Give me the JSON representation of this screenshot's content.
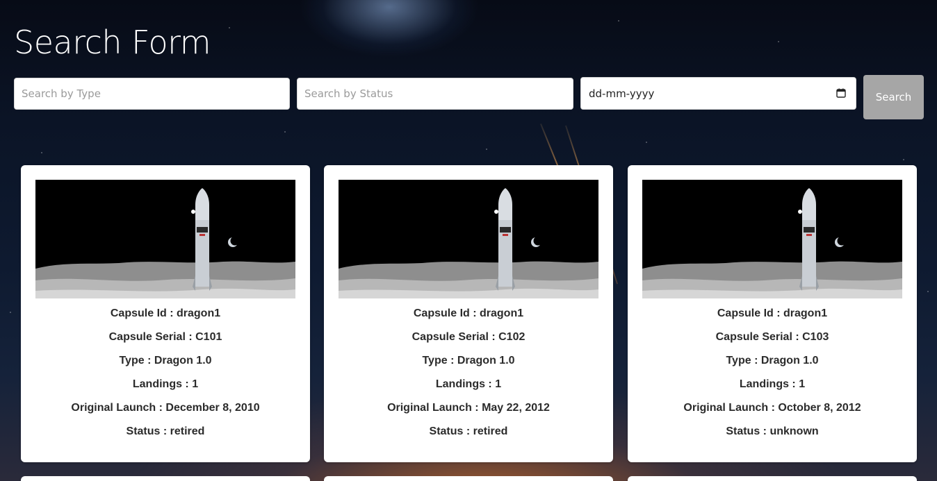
{
  "page": {
    "title": "Search Form"
  },
  "search": {
    "type_placeholder": "Search by Type",
    "status_placeholder": "Search by Status",
    "date_placeholder": "dd-mm-yyyy",
    "button_label": "Search"
  },
  "labels": {
    "capsule_id": "Capsule Id",
    "capsule_serial": "Capsule Serial",
    "type": "Type",
    "landings": "Landings",
    "original_launch": "Original Launch",
    "status": "Status"
  },
  "capsules": [
    {
      "capsule_id": "dragon1",
      "capsule_serial": "C101",
      "type": "Dragon 1.0",
      "landings": "1",
      "original_launch": "December 8, 2010",
      "status": "retired"
    },
    {
      "capsule_id": "dragon1",
      "capsule_serial": "C102",
      "type": "Dragon 1.0",
      "landings": "1",
      "original_launch": "May 22, 2012",
      "status": "retired"
    },
    {
      "capsule_id": "dragon1",
      "capsule_serial": "C103",
      "type": "Dragon 1.0",
      "landings": "1",
      "original_launch": "October 8, 2012",
      "status": "unknown"
    }
  ],
  "colors": {
    "card_bg": "#ffffff",
    "button_bg": "#a6a6a6",
    "text_dark": "#2b2b2b"
  }
}
